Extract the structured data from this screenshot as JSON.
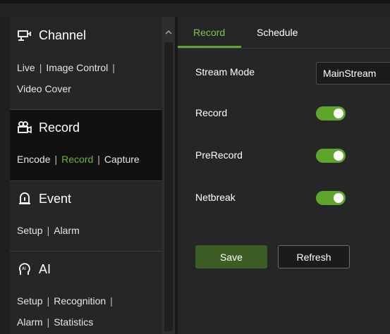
{
  "colors": {
    "accent": "#6fb33a",
    "toggle_on": "#5ea52b",
    "save_button": "#3c5e25"
  },
  "sidebar": {
    "sections": [
      {
        "title": "Channel",
        "icon": "camera-icon",
        "rows": [
          [
            "Live",
            "Image Control"
          ],
          [
            "Video Cover"
          ]
        ]
      },
      {
        "title": "Record",
        "icon": "video-recorder-icon",
        "rows": [
          [
            "Encode",
            "Record",
            "Capture"
          ]
        ],
        "current": "Record"
      },
      {
        "title": "Event",
        "icon": "alarm-bell-icon",
        "rows": [
          [
            "Setup",
            "Alarm"
          ]
        ]
      },
      {
        "title": "AI",
        "icon": "ai-head-icon",
        "rows": [
          [
            "Setup",
            "Recognition"
          ],
          [
            "Alarm",
            "Statistics"
          ]
        ]
      }
    ]
  },
  "tabs": {
    "record": "Record",
    "schedule": "Schedule"
  },
  "form": {
    "stream_mode": {
      "label": "Stream Mode",
      "value": "MainStream"
    },
    "record": {
      "label": "Record",
      "on": true
    },
    "prerecord": {
      "label": "PreRecord",
      "on": true
    },
    "netbreak": {
      "label": "Netbreak",
      "on": true
    }
  },
  "buttons": {
    "save": "Save",
    "refresh": "Refresh"
  }
}
